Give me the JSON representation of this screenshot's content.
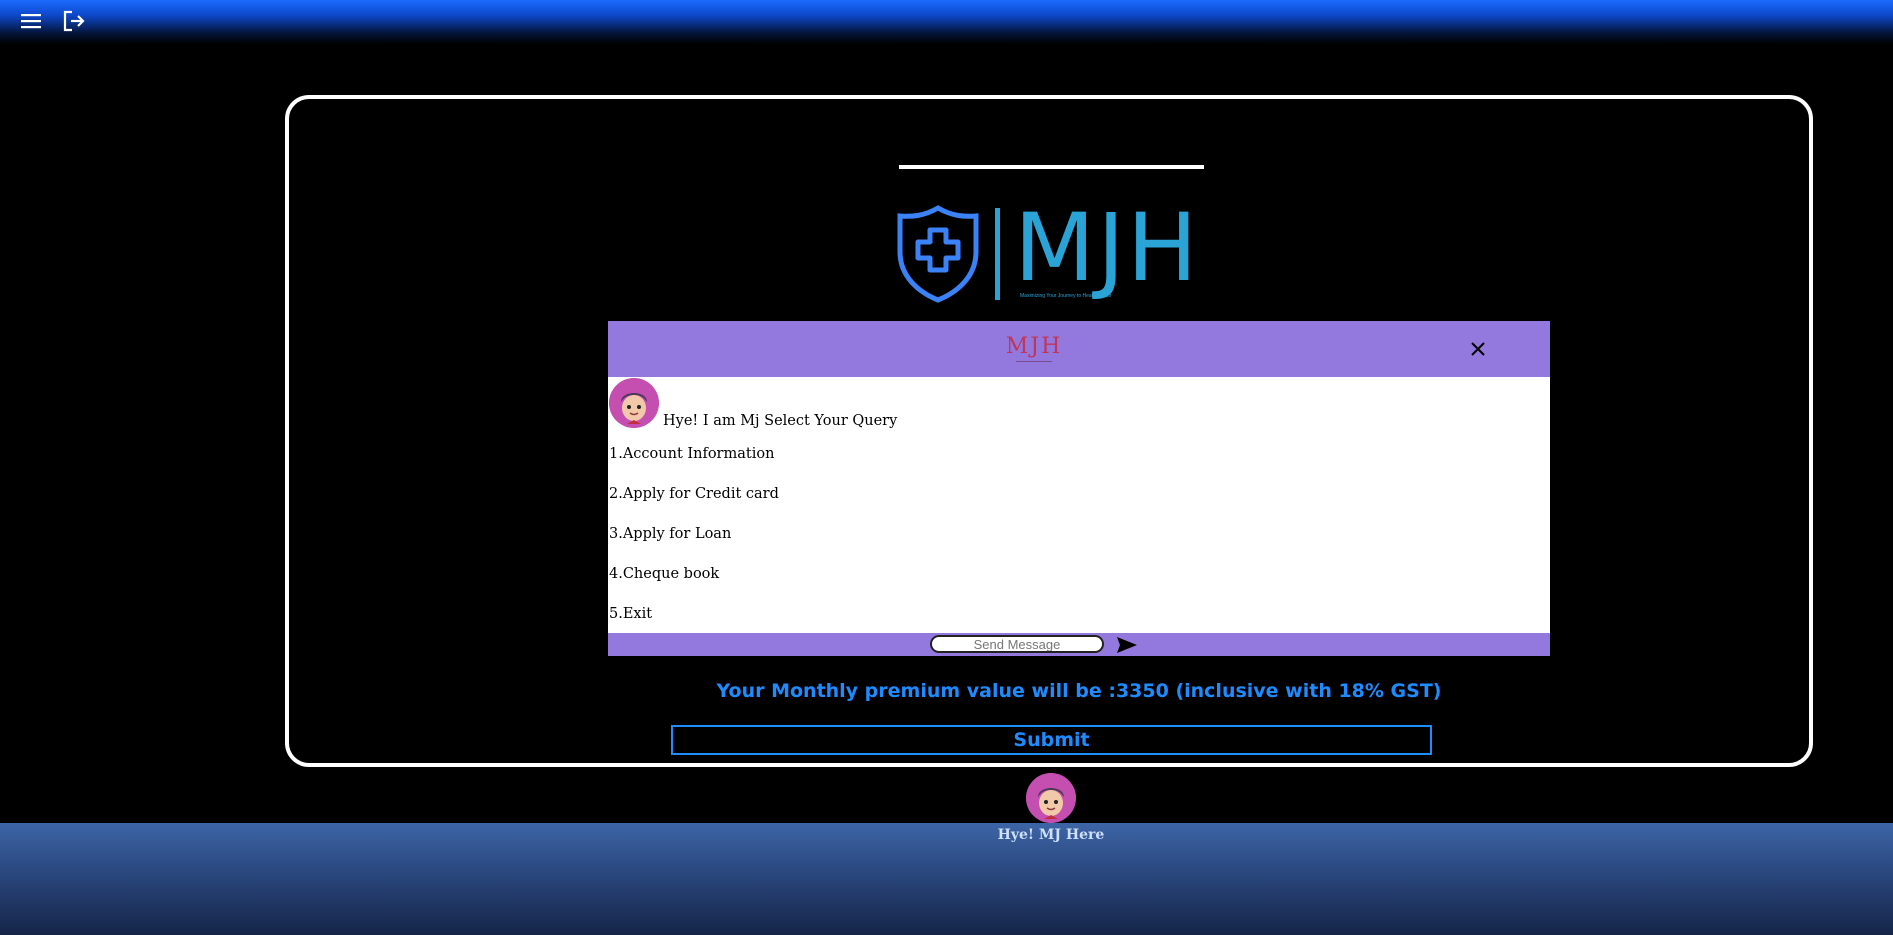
{
  "header": {
    "menu_icon": "hamburger-menu-icon",
    "logout_icon": "logout-icon"
  },
  "logo": {
    "wordmark": "MJH",
    "tagline": "Maximizing Your Journey to Health Secur",
    "color": "#2aa3d6",
    "shield_color": "#3b82f6"
  },
  "chat": {
    "header_brand": "MJH",
    "close_icon": "close-icon",
    "greeting": "Hye! I am Mj Select Your Query",
    "options": [
      "1.Account Information",
      "2.Apply for Credit card",
      "3.Apply for Loan",
      "4.Cheque book",
      "5.Exit"
    ],
    "input_placeholder": "Send Message",
    "send_icon": "send-icon",
    "accent": "#9379dd"
  },
  "premium": {
    "text": "Your Monthly premium value will be :3350 (inclusive with 18% GST)",
    "color": "#1e8bff"
  },
  "submit_label": "Submit",
  "chatbot_launcher": {
    "label": "Hye! MJ Here"
  }
}
